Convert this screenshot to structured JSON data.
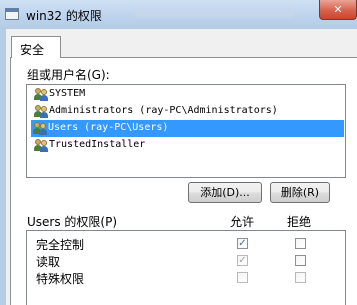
{
  "window": {
    "title": "win32 的权限",
    "close_glyph": "✕"
  },
  "tabs": [
    {
      "label": "安全"
    }
  ],
  "groups": {
    "label": "组或用户名(G):",
    "items": [
      {
        "name": "SYSTEM",
        "selected": false
      },
      {
        "name": "Administrators (ray-PC\\Administrators)",
        "selected": false
      },
      {
        "name": "Users (ray-PC\\Users)",
        "selected": true
      },
      {
        "name": "TrustedInstaller",
        "selected": false
      }
    ]
  },
  "buttons": {
    "add_label": "添加(D)...",
    "remove_label": "删除(R)"
  },
  "permissions": {
    "header": "Users 的权限(P)",
    "allow_label": "允许",
    "deny_label": "拒绝",
    "rows": [
      {
        "name": "完全控制",
        "allow": true,
        "deny": false
      },
      {
        "name": "读取",
        "allow": true,
        "deny": false
      },
      {
        "name": "特殊权限",
        "allow": false,
        "deny": false
      }
    ],
    "check_glyph": "✓"
  }
}
